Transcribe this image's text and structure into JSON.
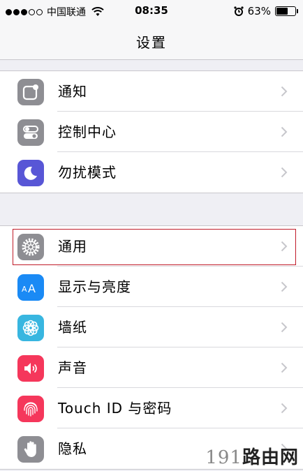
{
  "status_bar": {
    "carrier": "中国联通",
    "time": "08:35",
    "battery": "63%",
    "battery_level": 0.63,
    "signal_bars": 3
  },
  "nav": {
    "title": "设置"
  },
  "groups": [
    {
      "items": [
        {
          "label": "通知",
          "icon": "notifications-icon",
          "color": "#8e8e93"
        },
        {
          "label": "控制中心",
          "icon": "control-center-icon",
          "color": "#8e8e93"
        },
        {
          "label": "勿扰模式",
          "icon": "moon-icon",
          "color": "#5856d6"
        }
      ]
    },
    {
      "items": [
        {
          "label": "通用",
          "icon": "gear-icon",
          "color": "#8e8e93"
        },
        {
          "label": "显示与亮度",
          "icon": "display-brightness-icon",
          "color": "#1a8af5"
        },
        {
          "label": "墙纸",
          "icon": "wallpaper-icon",
          "color": "#38b6e0"
        },
        {
          "label": "声音",
          "icon": "speaker-icon",
          "color": "#f5375b"
        },
        {
          "label": "Touch ID 与密码",
          "icon": "fingerprint-icon",
          "color": "#f5375b"
        },
        {
          "label": "隐私",
          "icon": "hand-icon",
          "color": "#8e8e93"
        }
      ]
    }
  ],
  "watermark": {
    "num": "191",
    "text": "路由网"
  }
}
